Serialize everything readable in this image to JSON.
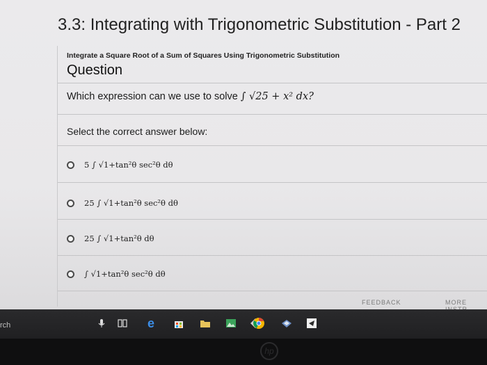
{
  "page": {
    "title": "3.3: Integrating with Trigonometric Substitution - Part 2",
    "subtitle": "Integrate a Square Root of a Sum of Squares Using Trigonometric Substitution",
    "question_heading": "Question",
    "prompt_prefix": "Which expression can we use to solve ",
    "prompt_math": "∫ √25 + x² dx?",
    "select_label": "Select the correct answer below:",
    "options": [
      "5 ∫ √1+tan²θ sec²θ dθ",
      "25 ∫ √1+tan²θ sec²θ dθ",
      "25 ∫ √1+tan²θ dθ",
      "∫ √1+tan²θ sec²θ dθ"
    ],
    "feedback_label": "FEEDBACK",
    "more_instruction_label": "MORE INSTR"
  },
  "taskbar": {
    "search_fragment": "rch",
    "icons": [
      "microphone-icon",
      "task-view-icon",
      "edge-icon",
      "store-icon",
      "file-explorer-icon",
      "photos-icon",
      "chrome-icon",
      "app-icon",
      "mail-icon"
    ]
  },
  "colors": {
    "taskbar": "#222224",
    "page_background": "#e9e8ea"
  }
}
